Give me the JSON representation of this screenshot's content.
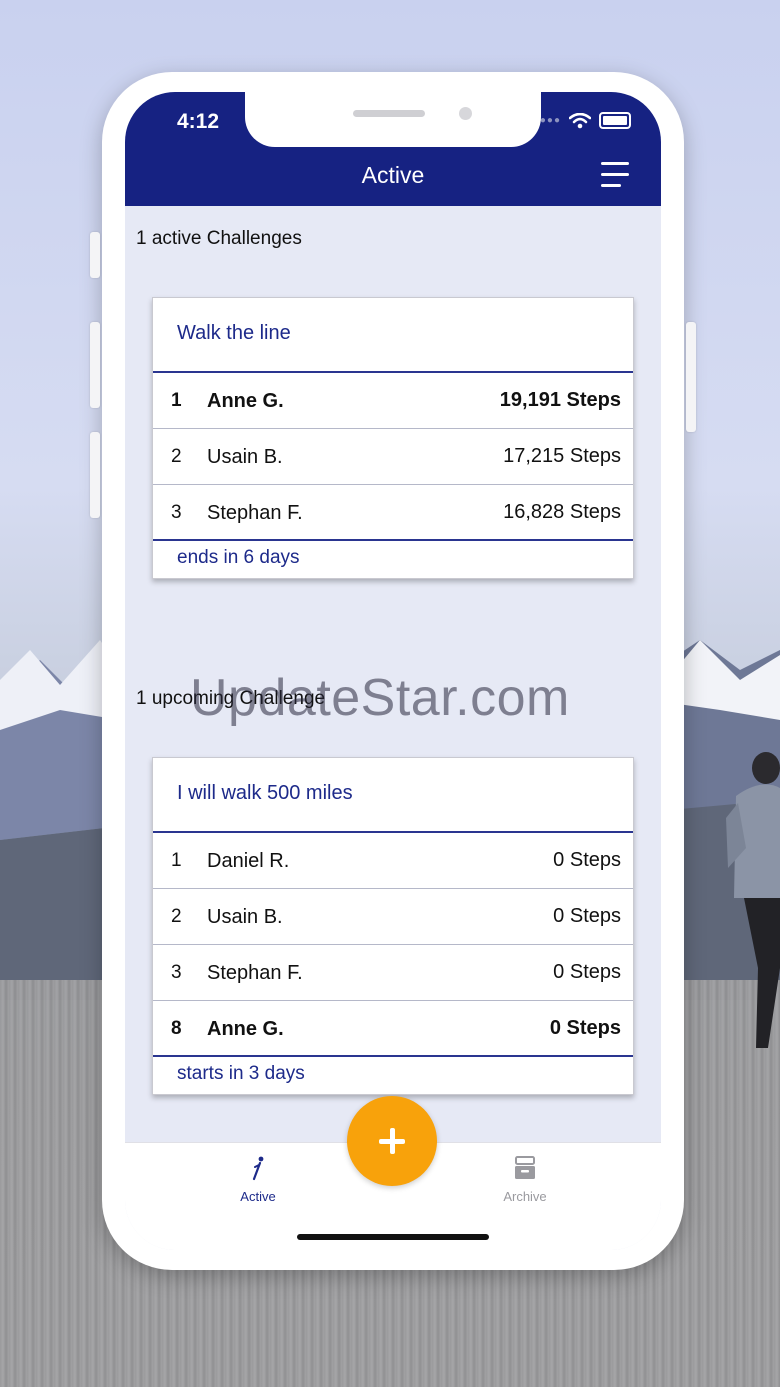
{
  "status_bar": {
    "time": "4:12"
  },
  "navbar": {
    "title": "Active"
  },
  "active_section": {
    "label": "1 active Challenges",
    "challenge": {
      "title": "Walk the line",
      "rows": [
        {
          "rank": "1",
          "name": "Anne G.",
          "steps": "19,191 Steps",
          "highlight": true
        },
        {
          "rank": "2",
          "name": "Usain B.",
          "steps": "17,215 Steps",
          "highlight": false
        },
        {
          "rank": "3",
          "name": "Stephan F.",
          "steps": "16,828 Steps",
          "highlight": false
        }
      ],
      "footer": "ends in 6 days"
    }
  },
  "upcoming_section": {
    "label": "1 upcoming Challenge",
    "challenge": {
      "title": "I will walk 500 miles",
      "rows": [
        {
          "rank": "1",
          "name": "Daniel R.",
          "steps": "0 Steps",
          "highlight": false
        },
        {
          "rank": "2",
          "name": "Usain B.",
          "steps": "0 Steps",
          "highlight": false
        },
        {
          "rank": "3",
          "name": "Stephan F.",
          "steps": "0 Steps",
          "highlight": false
        },
        {
          "rank": "8",
          "name": "Anne G.",
          "steps": "0 Steps",
          "highlight": true
        }
      ],
      "footer": "starts in 3 days"
    }
  },
  "watermark": "UpdateStar.com",
  "tabbar": {
    "active_label": "Active",
    "archive_label": "Archive",
    "active_icon": "walker-icon",
    "archive_icon": "archive-box-icon",
    "add_icon": "plus-icon"
  },
  "colors": {
    "header": "#162282",
    "accent_text": "#1d2a8a",
    "fab": "#f8a20b",
    "screen_bg": "#e6e9f5"
  }
}
